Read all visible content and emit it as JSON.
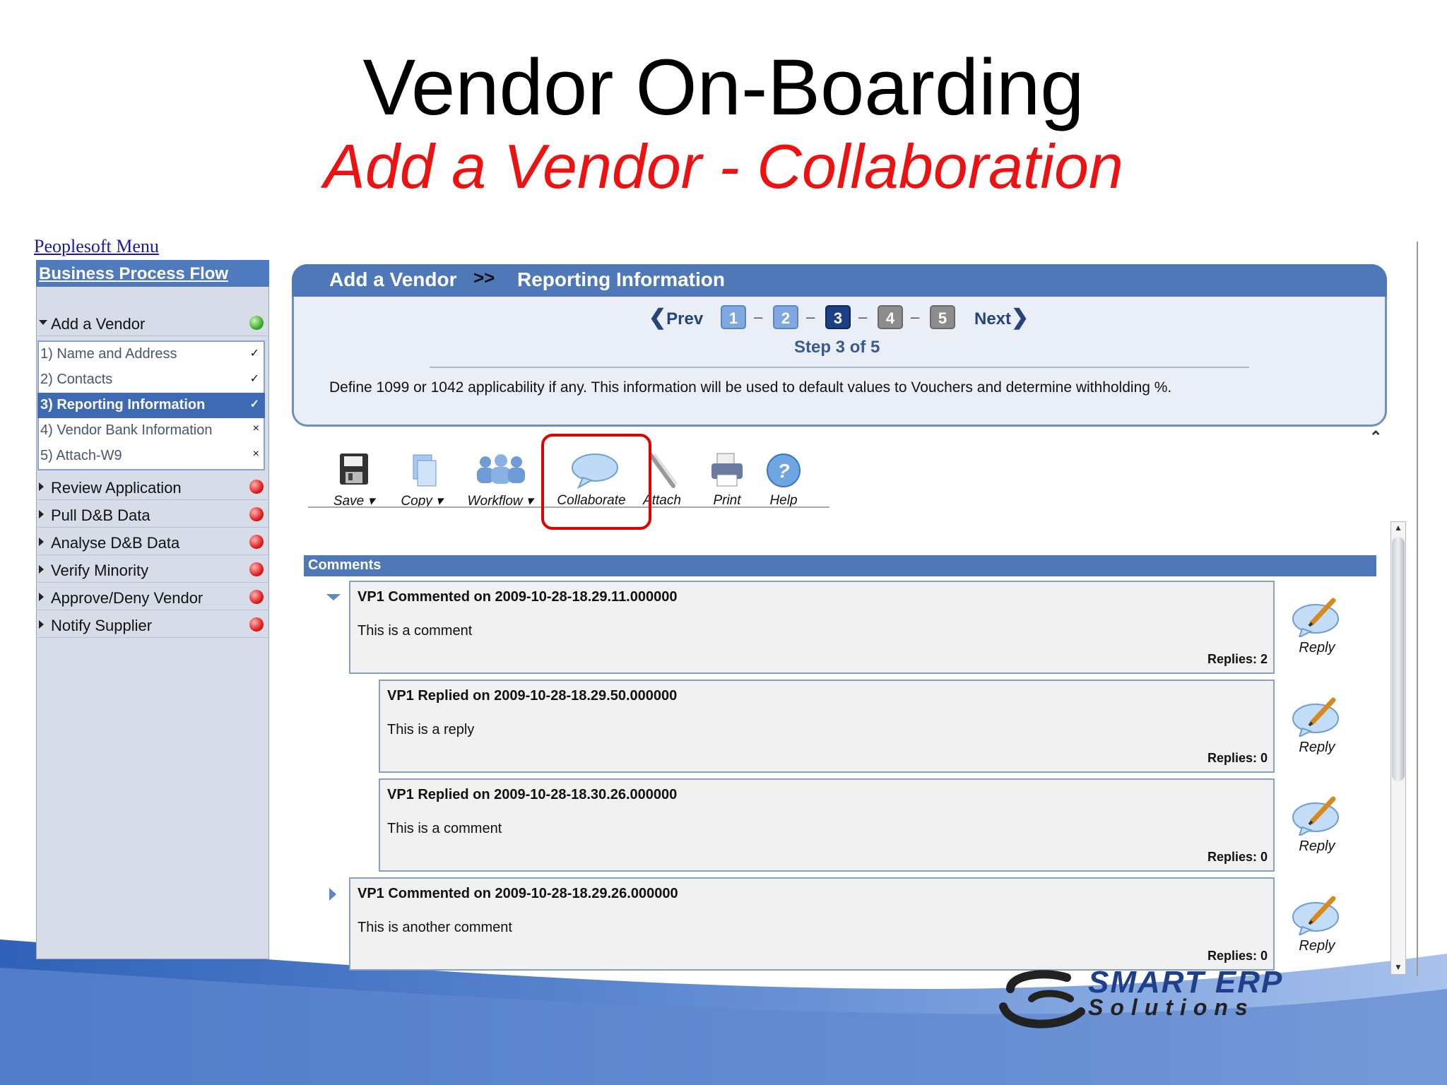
{
  "slide": {
    "title": "Vendor On-Boarding",
    "subtitle": "Add a Vendor - Collaboration"
  },
  "menu_link": "Peoplesoft Menu",
  "left_panel": {
    "header": "Business Process Flow",
    "sections": [
      {
        "label": "Add a Vendor",
        "status": "green",
        "expanded": true
      },
      {
        "label": "Review Application",
        "status": "red"
      },
      {
        "label": "Pull D&B Data",
        "status": "red"
      },
      {
        "label": "Analyse D&B Data",
        "status": "red"
      },
      {
        "label": "Verify Minority",
        "status": "red"
      },
      {
        "label": "Approve/Deny Vendor",
        "status": "red"
      },
      {
        "label": "Notify Supplier",
        "status": "red"
      }
    ],
    "steps": [
      {
        "label": "1) Name and Address",
        "mark": "✓",
        "active": false
      },
      {
        "label": "2) Contacts",
        "mark": "✓",
        "active": false
      },
      {
        "label": "3) Reporting Information",
        "mark": "✓",
        "active": true
      },
      {
        "label": "4) Vendor Bank Information",
        "mark": "×",
        "active": false
      },
      {
        "label": "5) Attach-W9",
        "mark": "×",
        "active": false
      }
    ]
  },
  "header": {
    "title": "Add a Vendor",
    "separator": ">>",
    "section": "Reporting Information",
    "prev_label": "Prev",
    "next_label": "Next",
    "pages": [
      "1",
      "2",
      "3",
      "4",
      "5"
    ],
    "current_page": 3,
    "step_label": "Step 3 of 5",
    "description": "Define 1099 or 1042 applicability if any. This information will be used to default values to Vouchers and determine withholding %."
  },
  "toolbar": {
    "save": "Save",
    "copy": "Copy",
    "workflow": "Workflow",
    "collaborate": "Collaborate",
    "attach": "Attach",
    "print": "Print",
    "help": "Help"
  },
  "comments": {
    "title": "Comments",
    "reply_label": "Reply",
    "items": [
      {
        "head": "VP1 Commented on 2009-10-28-18.29.11.000000",
        "body": "This is a comment",
        "replies": "Replies: 2"
      },
      {
        "head": "VP1 Replied on 2009-10-28-18.29.50.000000",
        "body": "This is a reply",
        "replies": "Replies: 0"
      },
      {
        "head": "VP1 Replied on 2009-10-28-18.30.26.000000",
        "body": "This is a comment",
        "replies": "Replies: 0"
      },
      {
        "head": "VP1 Commented on 2009-10-28-18.29.26.000000",
        "body": "This is another comment",
        "replies": "Replies: 0"
      }
    ]
  },
  "logo": {
    "line1": "SMART ERP",
    "line2": "Solutions"
  },
  "colors": {
    "accent_blue": "#4e78b8",
    "subtitle_red": "#ee1111",
    "highlight_red": "#e00000"
  }
}
